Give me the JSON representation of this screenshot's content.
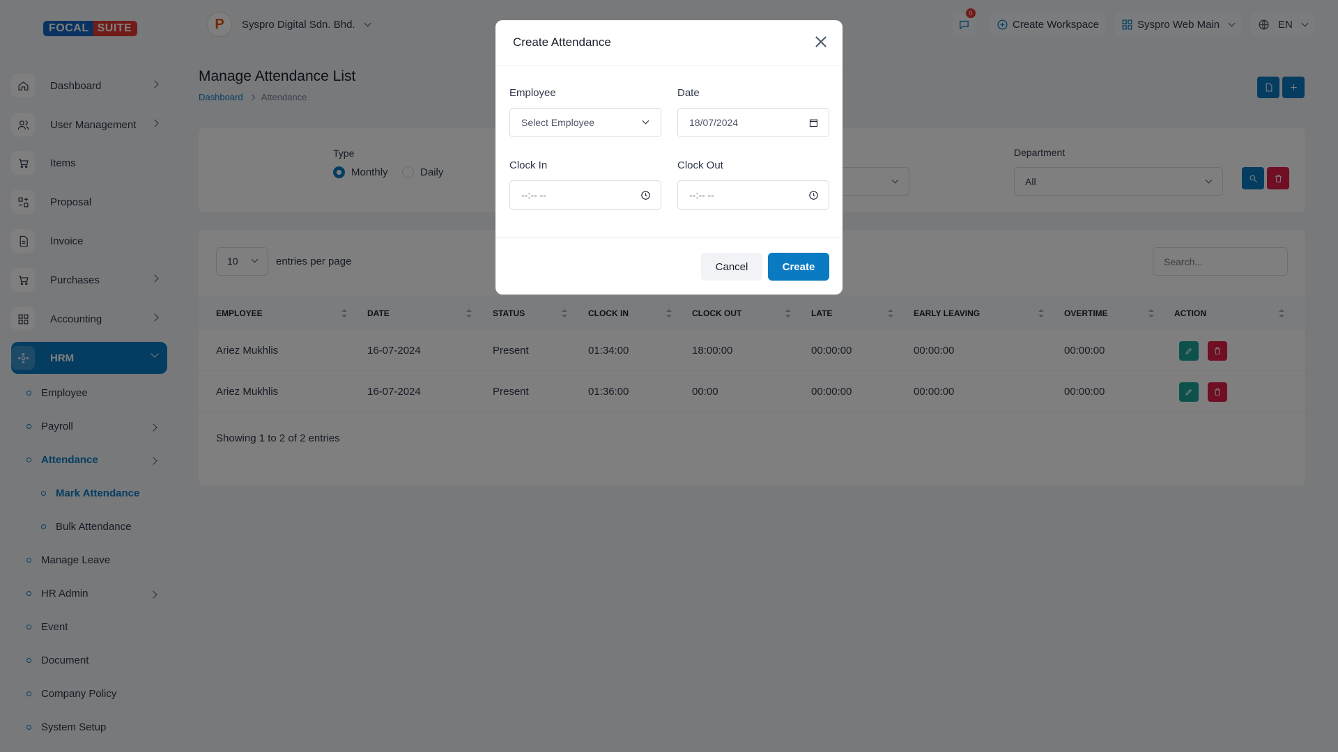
{
  "brand": {
    "part1": "FOCAL",
    "part2": "SUITE"
  },
  "sidebar": {
    "items": [
      {
        "label": "Dashboard",
        "icon": "home-icon"
      },
      {
        "label": "User Management",
        "icon": "users-icon"
      },
      {
        "label": "Items",
        "icon": "cart-icon"
      },
      {
        "label": "Proposal",
        "icon": "proposal-icon"
      },
      {
        "label": "Invoice",
        "icon": "invoice-icon"
      },
      {
        "label": "Purchases",
        "icon": "cart-icon"
      },
      {
        "label": "Accounting",
        "icon": "grid-icon"
      },
      {
        "label": "HRM",
        "icon": "hrm-icon"
      }
    ],
    "hrm_sub": [
      {
        "label": "Employee"
      },
      {
        "label": "Payroll"
      },
      {
        "label": "Attendance"
      },
      {
        "label": "Mark Attendance"
      },
      {
        "label": "Bulk Attendance"
      },
      {
        "label": "Manage Leave"
      },
      {
        "label": "HR Admin"
      },
      {
        "label": "Event"
      },
      {
        "label": "Document"
      },
      {
        "label": "Company Policy"
      },
      {
        "label": "System Setup"
      }
    ]
  },
  "topbar": {
    "company": "Syspro Digital Sdn. Bhd.",
    "notification_count": "0",
    "create_workspace": "Create Workspace",
    "workspace": "Syspro Web Main",
    "language": "EN"
  },
  "page": {
    "title": "Manage Attendance List",
    "breadcrumb_home": "Dashboard",
    "breadcrumb_current": "Attendance"
  },
  "filter": {
    "type_label": "Type",
    "type_monthly": "Monthly",
    "type_daily": "Daily",
    "department_label": "Department",
    "department_value": "All"
  },
  "table": {
    "entries_value": "10",
    "entries_label": "entries per page",
    "search_placeholder": "Search...",
    "headers": [
      "EMPLOYEE",
      "DATE",
      "STATUS",
      "CLOCK IN",
      "CLOCK OUT",
      "LATE",
      "EARLY LEAVING",
      "OVERTIME",
      "ACTION"
    ],
    "rows": [
      {
        "employee": "Ariez Mukhlis",
        "date": "16-07-2024",
        "status": "Present",
        "clock_in": "01:34:00",
        "clock_out": "18:00:00",
        "late": "00:00:00",
        "early_leaving": "00:00:00",
        "overtime": "00:00:00"
      },
      {
        "employee": "Ariez Mukhlis",
        "date": "16-07-2024",
        "status": "Present",
        "clock_in": "01:36:00",
        "clock_out": "00:00",
        "late": "00:00:00",
        "early_leaving": "00:00:00",
        "overtime": "00:00:00"
      }
    ],
    "showing": "Showing 1 to 2 of 2 entries"
  },
  "modal": {
    "title": "Create Attendance",
    "employee_label": "Employee",
    "employee_placeholder": "Select Employee",
    "date_label": "Date",
    "date_value": "18/07/2024",
    "clock_in_label": "Clock In",
    "clock_in_value": "--:-- --",
    "clock_out_label": "Clock Out",
    "clock_out_value": "--:-- --",
    "cancel": "Cancel",
    "create": "Create"
  },
  "colors": {
    "primary": "#0a7bc2",
    "danger": "#e11d48",
    "teal": "#1aa39a"
  }
}
